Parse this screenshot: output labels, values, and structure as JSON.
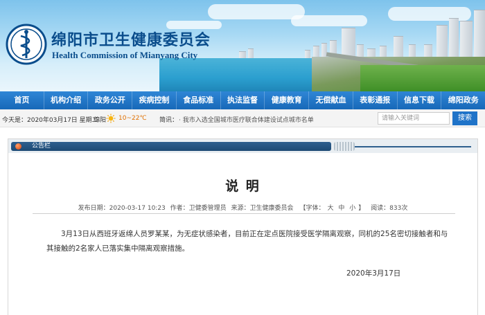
{
  "site": {
    "title": "绵阳市卫生健康委员会",
    "subtitle": "Health Commission of Mianyang City"
  },
  "nav": {
    "items": [
      "首页",
      "机构介绍",
      "政务公开",
      "疾病控制",
      "食品标准",
      "执法监督",
      "健康教育",
      "无偿献血",
      "表彰通报",
      "信息下载",
      "绵阳政务"
    ]
  },
  "infobar": {
    "date": "今天是：2020年03月17日 星期二",
    "city": "绵阳",
    "weather_icon": "sun-icon",
    "temperature": "10~22℃",
    "brief_label": "简讯：",
    "brief_text": "· 我市入选全国城市医疗联合体建设试点城市名单"
  },
  "search": {
    "placeholder": "请输入关键词",
    "button_label": "搜索"
  },
  "panel": {
    "tab_label": "公告栏"
  },
  "article": {
    "title": "说 明",
    "meta": {
      "publish_date": "发布日期：2020-03-17 10:23",
      "author": "作者：卫健委管理员",
      "source": "来源：卫生健康委员会",
      "font_label": "【字体：",
      "font_large": "大",
      "font_medium": "中",
      "font_small": "小",
      "font_close": "】",
      "views": "阅读：833次"
    },
    "body": "3月13日从西班牙返绵人员罗某某，为无症状感染者，目前正在定点医院接受医学隔离观察，同机的25名密切接触者和与其接触的2名家人已落实集中隔离观察措施。",
    "date": "2020年3月17日"
  },
  "colors": {
    "brand_blue": "#0a4d8c",
    "nav_blue": "#1f73c8",
    "tab_dark": "#2e5f8e",
    "accent_orange": "#e07000"
  }
}
